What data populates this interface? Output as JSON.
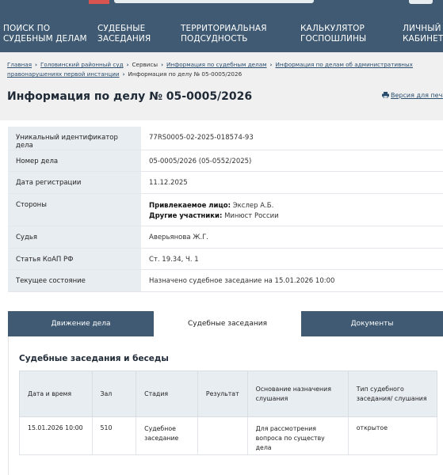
{
  "nav": {
    "items": [
      {
        "line1": "ПОИСК ПО",
        "line2": "СУДЕБНЫМ ДЕЛАМ"
      },
      {
        "line1": "СУДЕБНЫЕ",
        "line2": "ЗАСЕДАНИЯ"
      },
      {
        "line1": "ТЕРРИТОРИАЛЬНАЯ",
        "line2": "ПОДСУДНОСТЬ"
      },
      {
        "line1": "КАЛЬКУЛЯТОР",
        "line2": "ГОСПОШЛИНЫ"
      },
      {
        "line1": "ЛИЧНЫЙ",
        "line2": "КАБИНЕТ"
      }
    ]
  },
  "breadcrumb": {
    "items": [
      "Главная",
      "Головинский районный суд",
      "Сервисы",
      "Информация по судебным делам",
      "Информация по делам об административных правонарушениях первой инстанции",
      "Информация по делу № 05-0005/2026"
    ]
  },
  "page": {
    "title": "Информация по делу № 05-0005/2026",
    "print_label": "Версия для печати",
    "print_icon": "printer-icon"
  },
  "info": {
    "rows": [
      {
        "label": "Уникальный идентификатор дела",
        "value": "77RS0005-02-2025-018574-93"
      },
      {
        "label": "Номер дела",
        "value": "05-0005/2026 (05-0552/2025)"
      },
      {
        "label": "Дата регистрации",
        "value": "11.12.2025"
      },
      {
        "label": "Стороны"
      },
      {
        "label": "Судья",
        "value": "Аверьянова Ж.Г."
      },
      {
        "label": "Статья КоАП РФ",
        "value": "Ст. 19.34, Ч. 1"
      },
      {
        "label": "Текущее состояние",
        "value": "Назначено судебное заседание на 15.01.2026 10:00"
      }
    ],
    "parties": {
      "accused_label": "Привлекаемое лицо:",
      "accused_value": "Экслер А.Б.",
      "others_label": "Другие участники:",
      "others_value": "Минюст России"
    }
  },
  "tabs": [
    {
      "label": "Движение дела"
    },
    {
      "label": "Судебные заседания"
    },
    {
      "label": "Документы"
    }
  ],
  "hearings": {
    "title": "Судебные заседания и беседы",
    "headers": [
      "Дата и время",
      "Зал",
      "Стадия",
      "Результат",
      "Основание назначения слушания",
      "Тип судебного заседания/ слушания"
    ],
    "rows": [
      [
        "15.01.2026 10:00",
        "510",
        "Судебное заседание",
        "",
        "Для рассмотрения вопроса по существу дела",
        "открытое"
      ]
    ]
  },
  "colors": {
    "header_bg": "#3f5a72",
    "label_bg": "#e8edf2",
    "link": "#2a4d6e"
  }
}
